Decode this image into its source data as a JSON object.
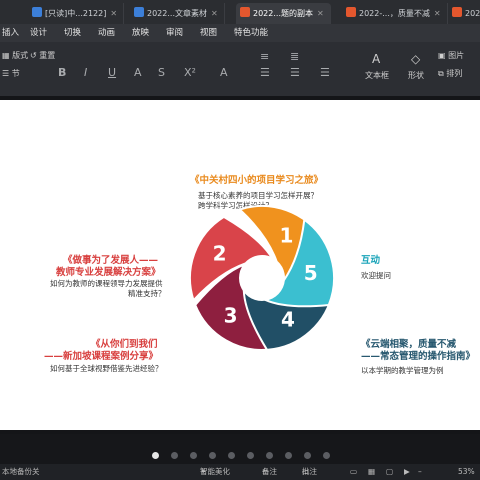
{
  "tabs": [
    {
      "label": "[只读]中...2122]",
      "icon_color": "#3c7fd9"
    },
    {
      "label": "2022...文章素材",
      "icon_color": "#3c7fd9"
    },
    {
      "label": "2022...题的副本",
      "icon_color": "#e4572e"
    },
    {
      "label": "2022-...，质量不减",
      "icon_color": "#e4572e"
    },
    {
      "label": "2022",
      "icon_color": "#e4572e"
    }
  ],
  "menu": [
    "插入",
    "设计",
    "切换",
    "动画",
    "放映",
    "审阅",
    "视图",
    "特色功能"
  ],
  "toolbar": {
    "textbox_label": "文本框",
    "shape_label": "形状",
    "picture_label": "图片",
    "arrange_label": "排列",
    "layout_label": "版式",
    "section_label": "节",
    "reset_label": "重置"
  },
  "slide": {
    "center_title": "《中关村四小的项目学习之旅》",
    "center_body": [
      "基于核心素养的项目学习怎样开展？",
      "跨学科学习怎样设计？"
    ],
    "left_top_title": [
      "《做事为了发展人——",
      "教师专业发展解决方案》"
    ],
    "left_top_body": [
      "如何为教师的课程领导力发展提供",
      "精准支持？"
    ],
    "left_bottom_title": [
      "《从你们到我们",
      "——新加坡课程案例分享》"
    ],
    "left_bottom_body": "如何基于全球视野借鉴先进经验？",
    "right_top_title": "互动",
    "right_top_body": "欢迎提问",
    "right_bottom_title": [
      "《云端相聚，质量不减",
      "——常态管理的操作指南》"
    ],
    "right_bottom_body": "以本学期的教学管理为例",
    "segments": [
      {
        "number": "1",
        "color": "#f0921e"
      },
      {
        "number": "2",
        "color": "#d9444a"
      },
      {
        "number": "3",
        "color": "#8e1f3f"
      },
      {
        "number": "4",
        "color": "#214f66"
      },
      {
        "number": "5",
        "color": "#3bbfd0"
      }
    ]
  },
  "status": {
    "left": "本地备份关",
    "beautify": "智能美化",
    "notes": "备注",
    "annotate": "批注",
    "zoom": "53%"
  }
}
